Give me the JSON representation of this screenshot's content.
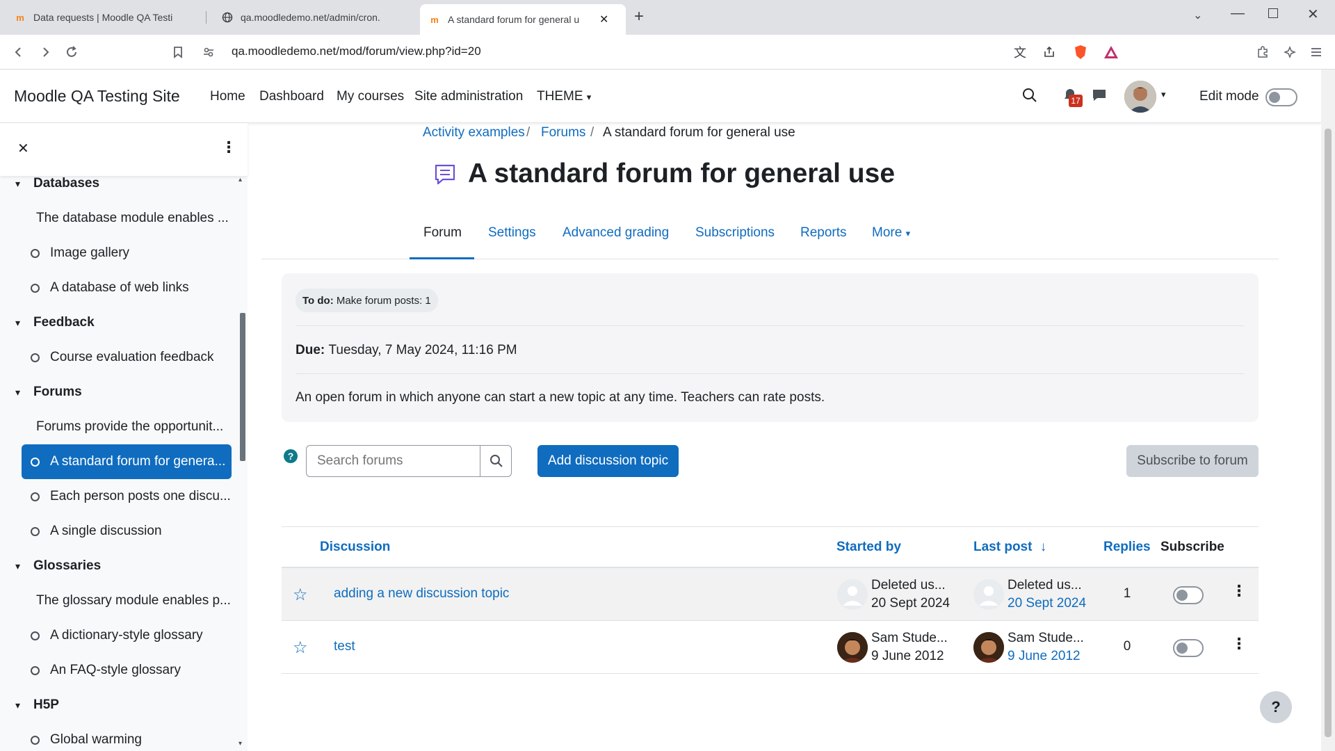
{
  "browser": {
    "tabs": [
      {
        "title": "Data requests | Moodle QA Testing",
        "icon": "moodle-icon"
      },
      {
        "title": "qa.moodledemo.net/admin/cron.ph",
        "icon": "globe-icon"
      },
      {
        "title": "A standard forum for general u",
        "icon": "moodle-icon"
      }
    ],
    "url": "qa.moodledemo.net/mod/forum/view.php?id=20",
    "badge_count": "17"
  },
  "header": {
    "site_name": "Moodle QA Testing Site",
    "nav": [
      "Home",
      "Dashboard",
      "My courses",
      "Site administration",
      "THEME"
    ],
    "edit_mode_label": "Edit mode"
  },
  "drawer": {
    "items": [
      {
        "type": "section",
        "label": "Databases"
      },
      {
        "type": "desc",
        "label": "The database module enables ..."
      },
      {
        "type": "mod",
        "label": "Image gallery"
      },
      {
        "type": "mod",
        "label": "A database of web links"
      },
      {
        "type": "section",
        "label": "Feedback"
      },
      {
        "type": "mod",
        "label": "Course evaluation feedback"
      },
      {
        "type": "section",
        "label": "Forums"
      },
      {
        "type": "desc",
        "label": "Forums provide the opportunit..."
      },
      {
        "type": "mod",
        "label": "A standard forum for genera...",
        "active": true
      },
      {
        "type": "mod",
        "label": "Each person posts one discu..."
      },
      {
        "type": "mod",
        "label": "A single discussion"
      },
      {
        "type": "section",
        "label": "Glossaries"
      },
      {
        "type": "desc",
        "label": "The glossary module enables p..."
      },
      {
        "type": "mod",
        "label": "A dictionary-style glossary"
      },
      {
        "type": "mod",
        "label": "An FAQ-style glossary"
      },
      {
        "type": "section",
        "label": "H5P"
      },
      {
        "type": "mod",
        "label": "Global warming"
      }
    ]
  },
  "breadcrumb": {
    "items": [
      "Activity examples",
      "Forums",
      "A standard forum for general use"
    ],
    "separator": "/"
  },
  "page": {
    "title": "A standard forum for general use",
    "tabs": [
      "Forum",
      "Settings",
      "Advanced grading",
      "Subscriptions",
      "Reports",
      "More"
    ]
  },
  "info": {
    "todo_label": "To do:",
    "todo_text": "Make forum posts: 1",
    "due_label": "Due:",
    "due_text": "Tuesday, 7 May 2024, 11:16 PM",
    "description": "An open forum in which anyone can start a new topic at any time. Teachers can rate posts."
  },
  "actions": {
    "search_placeholder": "Search forums",
    "add_label": "Add discussion topic",
    "subscribe_label": "Subscribe to forum"
  },
  "table": {
    "headers": {
      "discussion": "Discussion",
      "started_by": "Started by",
      "last_post": "Last post",
      "replies": "Replies",
      "subscribe": "Subscribe"
    },
    "rows": [
      {
        "title": "adding a new discussion topic",
        "started_name": "Deleted us...",
        "started_date": "20 Sept 2024",
        "last_name": "Deleted us...",
        "last_date": "20 Sept 2024",
        "replies": "1"
      },
      {
        "title": "test",
        "started_name": "Sam Stude...",
        "started_date": "9 June 2012",
        "last_name": "Sam Stude...",
        "last_date": "9 June 2012",
        "replies": "0"
      }
    ]
  },
  "colors": {
    "brand": "#0f6cbf",
    "active_drawer": "#0f6cbf",
    "forum_icon": "#6f4fd6"
  }
}
